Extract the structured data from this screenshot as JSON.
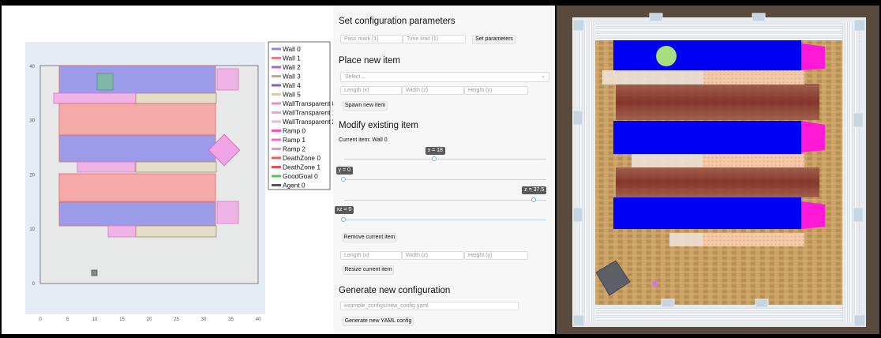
{
  "plot": {
    "x_ticks": [
      "0",
      "5",
      "10",
      "15",
      "20",
      "25",
      "30",
      "35",
      "40"
    ],
    "y_ticks": [
      "0",
      "10",
      "20",
      "30",
      "40"
    ],
    "legend": [
      {
        "label": "Wall 0",
        "color": "#8b8bdc"
      },
      {
        "label": "Wall 1",
        "color": "#e87f7f"
      },
      {
        "label": "Wall 2",
        "color": "#a569d6"
      },
      {
        "label": "Wall 3",
        "color": "#bdab87"
      },
      {
        "label": "Wall 4",
        "color": "#8a5cc4"
      },
      {
        "label": "Wall 5",
        "color": "#d8cdb0"
      },
      {
        "label": "WallTransparent 0",
        "color": "#e58ad1"
      },
      {
        "label": "WallTransparent 1",
        "color": "#e9a6dc"
      },
      {
        "label": "WallTransparent 2",
        "color": "#eeb3e3"
      },
      {
        "label": "Ramp 0",
        "color": "#f054c6"
      },
      {
        "label": "Ramp 1",
        "color": "#f06ac9"
      },
      {
        "label": "Ramp 2",
        "color": "#f28ad2"
      },
      {
        "label": "DeathZone 0",
        "color": "#f05a5a"
      },
      {
        "label": "DeathZone 1",
        "color": "#f04c4c"
      },
      {
        "label": "GoodGoal 0",
        "color": "#5bbf5b"
      },
      {
        "label": "Agent 0",
        "color": "#555555"
      }
    ]
  },
  "controls": {
    "set_config_title": "Set configuration parameters",
    "pass_mark_placeholder": "Pass mark (1)",
    "time_limit_placeholder": "Time limit (1)",
    "set_parameters_label": "Set parameters",
    "place_item_title": "Place new item",
    "select_placeholder": "Select...",
    "length_placeholder": "Length (x)",
    "width_placeholder": "Width (z)",
    "height_placeholder": "Height (y)",
    "spawn_label": "Spawn new item",
    "modify_title": "Modify existing item",
    "current_item": "Current item: Wall 0",
    "slider_x": {
      "label": "x = 18",
      "fraction": 0.45
    },
    "slider_y": {
      "label": "y = 0",
      "fraction": 0.0
    },
    "slider_z": {
      "label": "z = 37.5",
      "fraction": 0.94
    },
    "slider_xz": {
      "label": "xz = 0",
      "fraction": 0.0
    },
    "remove_label": "Remove current item",
    "resize_label": "Resize current item",
    "generate_title": "Generate new configuration",
    "yaml_placeholder": "example_configs/new_config.yaml",
    "generate_label": "Generate new YAML config"
  }
}
